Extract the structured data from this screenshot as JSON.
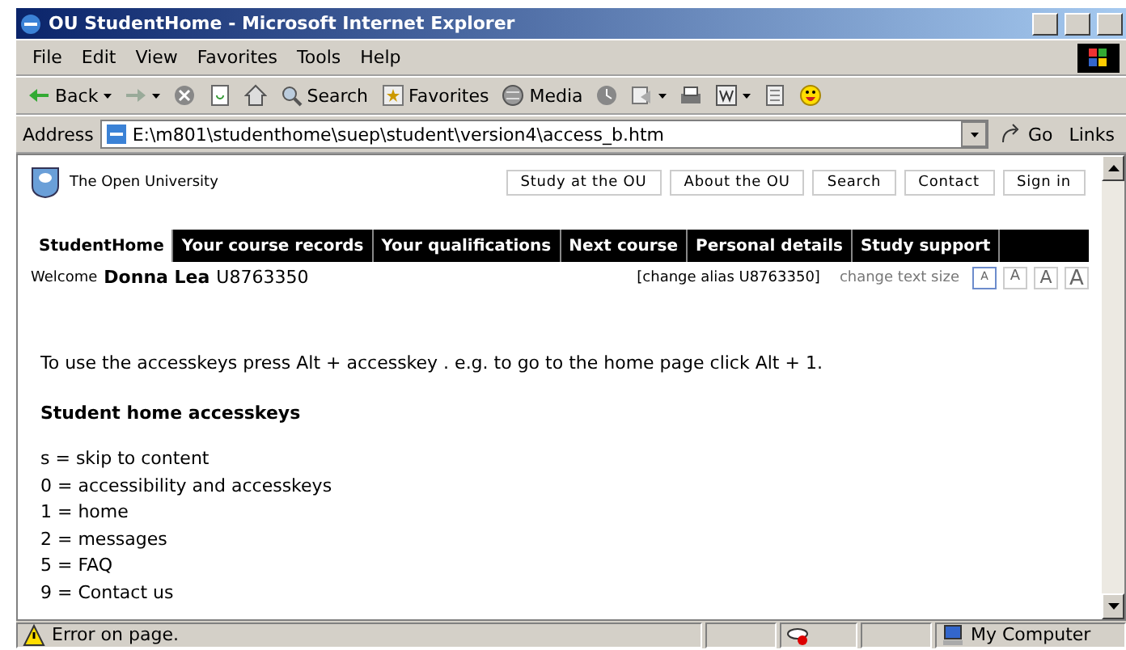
{
  "window": {
    "title": "OU StudentHome - Microsoft Internet Explorer"
  },
  "menu": [
    "File",
    "Edit",
    "View",
    "Favorites",
    "Tools",
    "Help"
  ],
  "toolbar": [
    {
      "kind": "back",
      "label": "Back"
    },
    {
      "kind": "forward"
    },
    {
      "kind": "stop"
    },
    {
      "kind": "refresh"
    },
    {
      "kind": "home"
    },
    {
      "kind": "search",
      "label": "Search"
    },
    {
      "kind": "favorites",
      "label": "Favorites"
    },
    {
      "kind": "media",
      "label": "Media"
    },
    {
      "kind": "history"
    },
    {
      "kind": "mail"
    },
    {
      "kind": "print"
    },
    {
      "kind": "edit"
    },
    {
      "kind": "discuss"
    },
    {
      "kind": "smiley"
    }
  ],
  "address": {
    "label": "Address",
    "value": "E:\\m801\\studenthome\\suep\\student\\version4\\access_b.htm",
    "go": "Go",
    "links": "Links"
  },
  "site": {
    "logo_text": "The Open University",
    "top_links": [
      "Study at the OU",
      "About the OU",
      "Search",
      "Contact",
      "Sign in"
    ],
    "tabs": [
      {
        "label": "StudentHome",
        "selected": true
      },
      {
        "label": "Your course records",
        "selected": false
      },
      {
        "label": "Your qualifications",
        "selected": false
      },
      {
        "label": "Next course",
        "selected": false
      },
      {
        "label": "Personal details",
        "selected": false
      },
      {
        "label": "Study support",
        "selected": false
      }
    ],
    "welcome": {
      "label": "Welcome",
      "name": "Donna Lea",
      "id": "U8763350"
    },
    "change_alias": "[change alias U8763350]",
    "text_size": {
      "label": "change text size",
      "sizes": [
        {
          "label": "A",
          "selected": true
        },
        {
          "label": "A",
          "selected": false
        },
        {
          "label": "A",
          "selected": false
        },
        {
          "label": "A",
          "selected": false
        }
      ]
    },
    "intro": "To use the accesskeys press Alt + accesskey . e.g. to go to the home page click Alt + 1.",
    "heading": "Student home accesskeys",
    "keys": [
      "s = skip to content",
      "0 = accessibility and accesskeys",
      "1 = home",
      "2 = messages",
      "5 = FAQ",
      "9 = Contact us"
    ]
  },
  "status_bar": {
    "message": "Error on page.",
    "zone": "My Computer"
  }
}
